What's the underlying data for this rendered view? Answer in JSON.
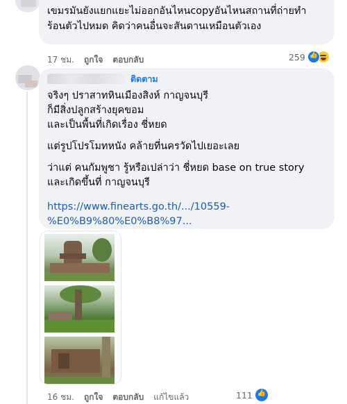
{
  "comment1": {
    "lines": [
      "เขมรมันยังแยกแยะไม่ออกอันไหนcopyอันไหนสถานที่ถ่ายทำ",
      "ร้อนตัวไปหมด คิดว่าคนอื่นจะสันดานเหมือนตัวเอง"
    ],
    "time": "17 ชม.",
    "like": "ถูกใจ",
    "reply": "ตอบกลับ",
    "reaction_count": "259",
    "reaction_icons": [
      "like-icon",
      "haha-icon"
    ]
  },
  "comment2": {
    "follow": "ติดตาม",
    "paragraphs": [
      [
        "จริงๆ ปราสาทหินเมืองสิงห์ กาญจนบุรี",
        "ก็มีสิ่งปลูกสร้างยุคขอม",
        "และเป็นพื้นที่เกิดเรื่อง ชี่หยด"
      ],
      [
        "แต่รูปโปรโมทหนัง คล้ายที่นครวัดไปเยอะเลย"
      ],
      [
        "ว่าแต่ คนกัมพูชา รู้หรือเปล่าว่า ชี่หยด base on true story",
        "และเกิดขึ้นที่ กาญจนบุรี"
      ]
    ],
    "link": [
      "https://www.finearts.go.th/.../10559-",
      "%E0%B9%80%E0%B8%97..."
    ],
    "time": "16 ชม.",
    "like": "ถูกใจ",
    "reply": "ตอบกลับ",
    "edited": "แก้ไขแล้ว",
    "reaction_count": "111",
    "reaction_icons": [
      "like-icon"
    ]
  },
  "colors": {
    "bubble": "#f0f2f5",
    "link": "#1b5bb5",
    "accent": "#1877f2",
    "meta": "#65676b"
  }
}
